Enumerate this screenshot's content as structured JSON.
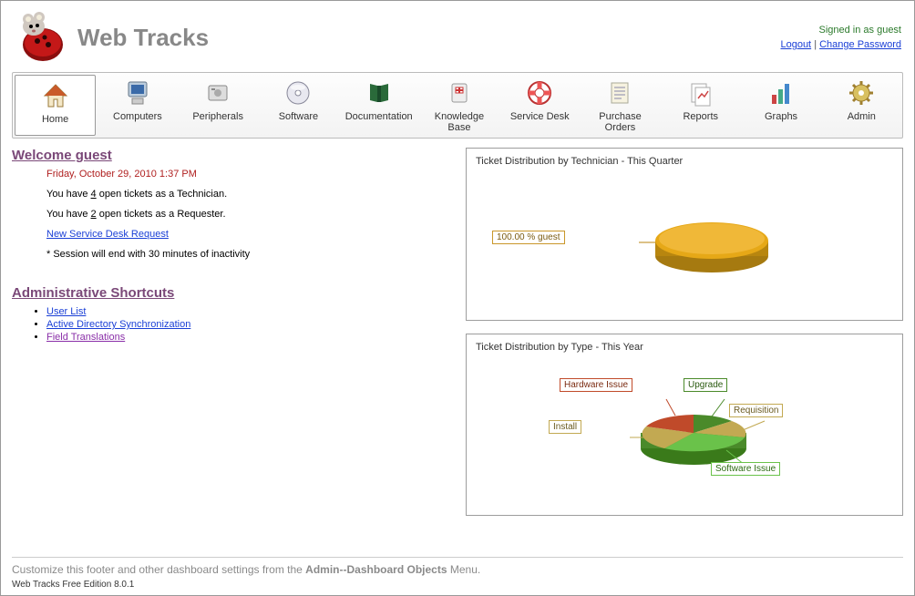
{
  "app_title": "Web Tracks",
  "auth": {
    "signed_in": "Signed in as guest",
    "logout": "Logout",
    "change_password": "Change Password"
  },
  "nav": [
    {
      "key": "home",
      "label": "Home",
      "active": true
    },
    {
      "key": "computers",
      "label": "Computers"
    },
    {
      "key": "peripherals",
      "label": "Peripherals"
    },
    {
      "key": "software",
      "label": "Software"
    },
    {
      "key": "documentation",
      "label": "Documentation"
    },
    {
      "key": "knowledge",
      "label": "Knowledge Base"
    },
    {
      "key": "servicedesk",
      "label": "Service Desk"
    },
    {
      "key": "purchase",
      "label": "Purchase Orders"
    },
    {
      "key": "reports",
      "label": "Reports"
    },
    {
      "key": "graphs",
      "label": "Graphs"
    },
    {
      "key": "admin",
      "label": "Admin"
    }
  ],
  "welcome": {
    "title": "Welcome guest",
    "date": "Friday, October 29, 2010 1:37 PM",
    "tech_prefix": "You have ",
    "tech_count": "4",
    "tech_suffix": " open tickets as a Technician.",
    "req_prefix": "You have ",
    "req_count": "2",
    "req_suffix": " open tickets as a Requester.",
    "new_request": "New Service Desk Request",
    "session_note": "* Session will end with 30 minutes of inactivity"
  },
  "admin_shortcuts": {
    "title": "Administrative Shortcuts",
    "items": [
      {
        "label": "User List"
      },
      {
        "label": "Active Directory Synchronization"
      },
      {
        "label": "Field Translations",
        "visited": true
      }
    ]
  },
  "charts": {
    "chart1_title": "Ticket Distribution by Technician - This Quarter",
    "chart1_label": "100.00 % guest",
    "chart2_title": "Ticket Distribution by Type - This Year",
    "chart2_labels": {
      "hardware": "Hardware Issue",
      "upgrade": "Upgrade",
      "requisition": "Requisition",
      "install": "Install",
      "software": "Software Issue"
    }
  },
  "footer": {
    "msg_prefix": "Customize this footer and other dashboard settings from the ",
    "msg_bold": "Admin--Dashboard Objects",
    "msg_suffix": " Menu.",
    "version": "Web Tracks Free Edition 8.0.1"
  },
  "chart_data": [
    {
      "type": "pie",
      "title": "Ticket Distribution by Technician - This Quarter",
      "series": [
        {
          "name": "guest",
          "value": 100.0,
          "color": "#d9a020"
        }
      ]
    },
    {
      "type": "pie",
      "title": "Ticket Distribution by Type - This Year",
      "series": [
        {
          "name": "Hardware Issue",
          "value": 12,
          "color": "#c04a2a"
        },
        {
          "name": "Upgrade",
          "value": 12,
          "color": "#4a8a2a"
        },
        {
          "name": "Requisition",
          "value": 12,
          "color": "#c2a952"
        },
        {
          "name": "Software Issue",
          "value": 40,
          "color": "#6ac24a"
        },
        {
          "name": "Install",
          "value": 24,
          "color": "#c2a952"
        }
      ]
    }
  ]
}
